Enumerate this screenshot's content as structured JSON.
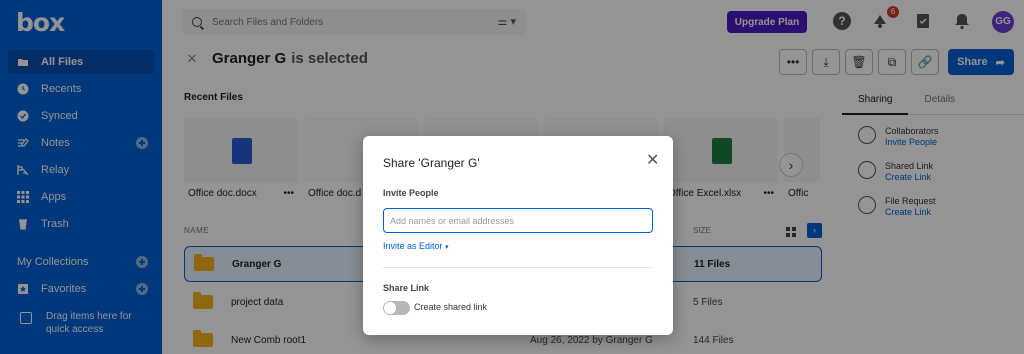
{
  "sidebar": {
    "logo": "box",
    "items": [
      {
        "label": "All Files",
        "icon": "folder-icon"
      },
      {
        "label": "Recents",
        "icon": "clock-icon"
      },
      {
        "label": "Synced",
        "icon": "check-circle-icon"
      },
      {
        "label": "Notes",
        "icon": "notes-icon"
      },
      {
        "label": "Relay",
        "icon": "relay-icon"
      },
      {
        "label": "Apps",
        "icon": "apps-grid-icon"
      },
      {
        "label": "Trash",
        "icon": "trash-icon"
      }
    ],
    "collections_label": "My Collections",
    "favorites_label": "Favorites",
    "drag_hint": "Drag items here for quick access"
  },
  "topbar": {
    "search_placeholder": "Search Files and Folders",
    "upgrade_label": "Upgrade Plan",
    "notification_count": "6",
    "avatar_initials": "GG"
  },
  "selection": {
    "name": "Granger G",
    "suffix": "is selected",
    "share_label": "Share"
  },
  "recent": {
    "title": "Recent Files",
    "cards": [
      {
        "name": "Office doc.docx"
      },
      {
        "name": "Office doc.d"
      },
      {
        "name": ""
      },
      {
        "name": ""
      },
      {
        "name": "Office Excel.xlsx"
      },
      {
        "name": "Offic"
      }
    ]
  },
  "table": {
    "name_header": "NAME",
    "size_header": "SIZE",
    "rows": [
      {
        "name": "Granger G",
        "modified": "",
        "size": "11 Files"
      },
      {
        "name": "project data",
        "modified": "",
        "size": "5 Files"
      },
      {
        "name": "New Comb root1",
        "modified": "Aug 26, 2022 by Granger G",
        "size": "144 Files"
      }
    ]
  },
  "side_panel": {
    "tabs": [
      "Sharing",
      "Details"
    ],
    "items": [
      {
        "label": "Collaborators",
        "link": "Invite People"
      },
      {
        "label": "Shared Link",
        "link": "Create Link"
      },
      {
        "label": "File Request",
        "link": "Create Link"
      }
    ]
  },
  "modal": {
    "title": "Share 'Granger G'",
    "invite_label": "Invite People",
    "input_placeholder": "Add names or email addresses",
    "role_label": "Invite as Editor",
    "share_link_label": "Share Link",
    "toggle_label": "Create shared link"
  },
  "colors": {
    "brand": "#0061d5",
    "upgrade": "#4c18c1",
    "folder": "#f5b31b"
  }
}
